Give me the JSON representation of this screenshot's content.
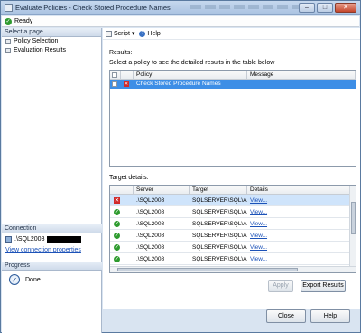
{
  "window": {
    "title": "Evaluate Policies - Check Stored Procedure Names",
    "min": "–",
    "max": "□",
    "close": "✕"
  },
  "status": {
    "text": "Ready"
  },
  "sidebar": {
    "header": "Select a page",
    "items": [
      {
        "label": "Policy Selection"
      },
      {
        "label": "Evaluation Results"
      }
    ]
  },
  "connection": {
    "header": "Connection",
    "server": ".\\SQL2008",
    "link": "View connection properties"
  },
  "progress": {
    "header": "Progress",
    "text": "Done"
  },
  "toolbar": {
    "script": "Script",
    "help": "Help",
    "dropdown": "▾"
  },
  "results": {
    "label": "Results:",
    "hint": "Select a policy to see the detailed results in the table below",
    "columns": [
      "Policy",
      "Message"
    ],
    "row": {
      "policy": "Check Stored Procedure Names",
      "message": ""
    }
  },
  "target": {
    "label": "Target details:",
    "columns": [
      "Server",
      "Target",
      "Details"
    ],
    "rows": [
      {
        "status": "fail",
        "server": ".\\SQL2008",
        "target": "SQLSERVER\\SQL\\A...",
        "details": "View..."
      },
      {
        "status": "ok",
        "server": ".\\SQL2008",
        "target": "SQLSERVER\\SQL\\A...",
        "details": "View..."
      },
      {
        "status": "ok",
        "server": ".\\SQL2008",
        "target": "SQLSERVER\\SQL\\A...",
        "details": "View..."
      },
      {
        "status": "ok",
        "server": ".\\SQL2008",
        "target": "SQLSERVER\\SQL\\A...",
        "details": "View..."
      },
      {
        "status": "ok",
        "server": ".\\SQL2008",
        "target": "SQLSERVER\\SQL\\A...",
        "details": "View..."
      },
      {
        "status": "ok",
        "server": ".\\SQL2008",
        "target": "SQLSERVER\\SQL\\A...",
        "details": "View..."
      }
    ]
  },
  "buttons": {
    "apply": "Apply",
    "export": "Export Results",
    "close": "Close",
    "help": "Help"
  }
}
